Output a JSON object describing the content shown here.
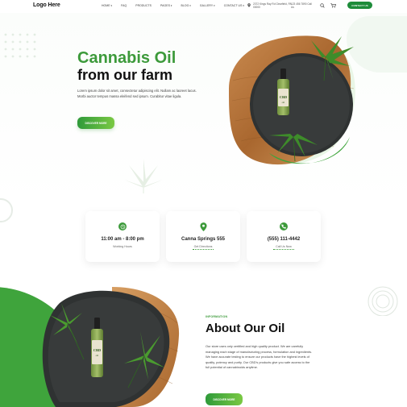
{
  "header": {
    "logo": "Logo Here",
    "nav": [
      {
        "label": "HOME",
        "caret": true
      },
      {
        "label": "FAQ",
        "caret": false
      },
      {
        "label": "PRODUCTS",
        "caret": false
      },
      {
        "label": "PAGES",
        "caret": true
      },
      {
        "label": "BLOG",
        "caret": true
      },
      {
        "label": "GALLERY",
        "caret": true
      },
      {
        "label": "CONTACT US",
        "caret": true
      }
    ],
    "address": "2372 Kings Ray Rd Clearfield, PA 00000",
    "phone": "123 456 7890 Call Us",
    "contact_button": "CONTACT US"
  },
  "hero": {
    "title_line1": "Cannabis Oil",
    "title_line2": "from our farm",
    "description": "Lorem ipsum dolor sit amet, consectetur adipiscing elit. Nullam ac laoreet lacus. Morbi auctor tempus massa eleifend sed ipsum. Curabitur vitae ligula.",
    "button": "DISCOVER MORE"
  },
  "cards": [
    {
      "icon": "clock-icon",
      "title": "11:00 am - 8:00 pm",
      "subtitle": "Working Hours",
      "underline": false
    },
    {
      "icon": "map-pin-icon",
      "title": "Canna Springs 555",
      "subtitle": "Get Directions",
      "underline": true
    },
    {
      "icon": "phone-icon",
      "title": "(555) 111-4442",
      "subtitle": "Call Us Now",
      "underline": true
    }
  ],
  "about": {
    "eyebrow": "INFORMATION",
    "title": "About Our Oil",
    "description": "Our store uses only certified and high quality product. We are carefully managing each stage of manufacturing process, formulation and ingredients. We have accurate testing to ensure our products have the highest levels of quality, potency and purity. Our CBD's products give you safe access to the full potential of cannabinoids anytime.",
    "button": "DISCOVER MORE"
  },
  "product": {
    "label": "CBD oil"
  },
  "colors": {
    "brand_green": "#3c9a3a",
    "dark_green": "#1e8c3a",
    "light_green": "#7ac943"
  }
}
